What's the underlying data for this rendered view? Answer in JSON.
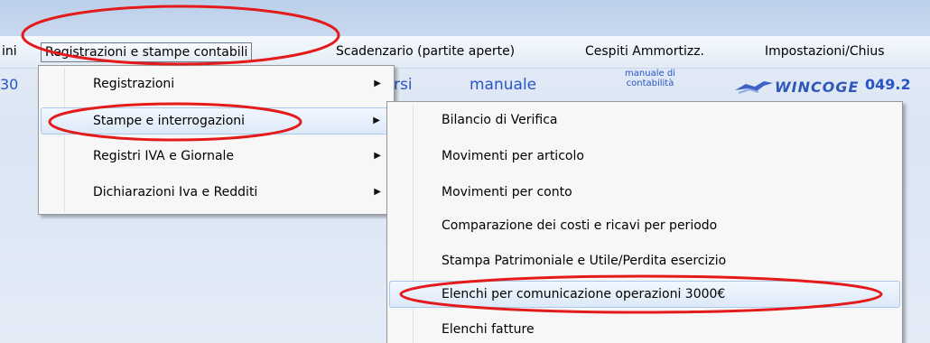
{
  "menubar": {
    "items": [
      {
        "label": "ini"
      },
      {
        "label": "Registrazioni e stampe contabili"
      },
      {
        "label": "Scadenzario (partite aperte)"
      },
      {
        "label": "Cespiti Ammortizz."
      },
      {
        "label": "Impostazioni/Chius"
      }
    ]
  },
  "toolbar": {
    "left_fragment": "30",
    "corsi_fragment": "rsi",
    "manuale_label": "manuale",
    "manuale_contabilita_label": "manuale di contabilità",
    "logo_text": "WINCOGE",
    "phone_fragment": "049.2"
  },
  "menu_main": {
    "items": [
      {
        "label": "Registrazioni",
        "arrow": "▶"
      },
      {
        "label": "Stampe e interrogazioni",
        "arrow": "▶"
      },
      {
        "label": "Registri IVA e Giornale",
        "arrow": "▶"
      },
      {
        "label": "Dichiarazioni Iva e Redditi",
        "arrow": "▶"
      }
    ]
  },
  "menu_sub": {
    "items": [
      {
        "label": "Bilancio di Verifica"
      },
      {
        "label": "Movimenti per articolo"
      },
      {
        "label": "Movimenti per conto"
      },
      {
        "label": "Comparazione dei costi e ricavi per periodo"
      },
      {
        "label": "Stampa Patrimoniale e Utile/Perdita esercizio"
      },
      {
        "label": "Elenchi per comunicazione operazioni 3000€"
      },
      {
        "label": "Elenchi fatture"
      }
    ]
  },
  "colors": {
    "annotation_red": "#e31b1b",
    "link_blue": "#2855c8"
  }
}
